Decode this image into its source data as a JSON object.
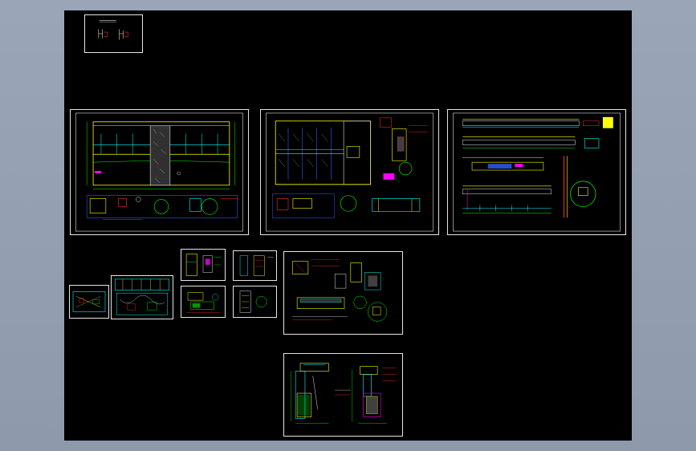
{
  "app": {
    "name": "",
    "background": "#96a2b4",
    "canvas_background": "#000000"
  },
  "colors": {
    "frame": "#e6e6e6",
    "yellow": "#ffff00",
    "cyan": "#00ffff",
    "green": "#00ff00",
    "red": "#ff3030",
    "magenta": "#ff00ff",
    "blue": "#3060ff",
    "gray": "#b4b4b4"
  },
  "sheets": [
    {
      "id": "sheet-legend",
      "kind": "legend"
    },
    {
      "id": "sheet-elevation-a",
      "kind": "elevation"
    },
    {
      "id": "sheet-elevation-b",
      "kind": "elevation"
    },
    {
      "id": "sheet-elevation-c",
      "kind": "section"
    },
    {
      "id": "sheet-plan-small-1",
      "kind": "plan"
    },
    {
      "id": "sheet-plan-small-2",
      "kind": "plan"
    },
    {
      "id": "sheet-detail-1",
      "kind": "detail"
    },
    {
      "id": "sheet-detail-2",
      "kind": "detail"
    },
    {
      "id": "sheet-detail-3",
      "kind": "detail"
    },
    {
      "id": "sheet-detail-4",
      "kind": "detail"
    },
    {
      "id": "sheet-detail-5",
      "kind": "detail"
    },
    {
      "id": "sheet-section-bottom",
      "kind": "section"
    }
  ]
}
